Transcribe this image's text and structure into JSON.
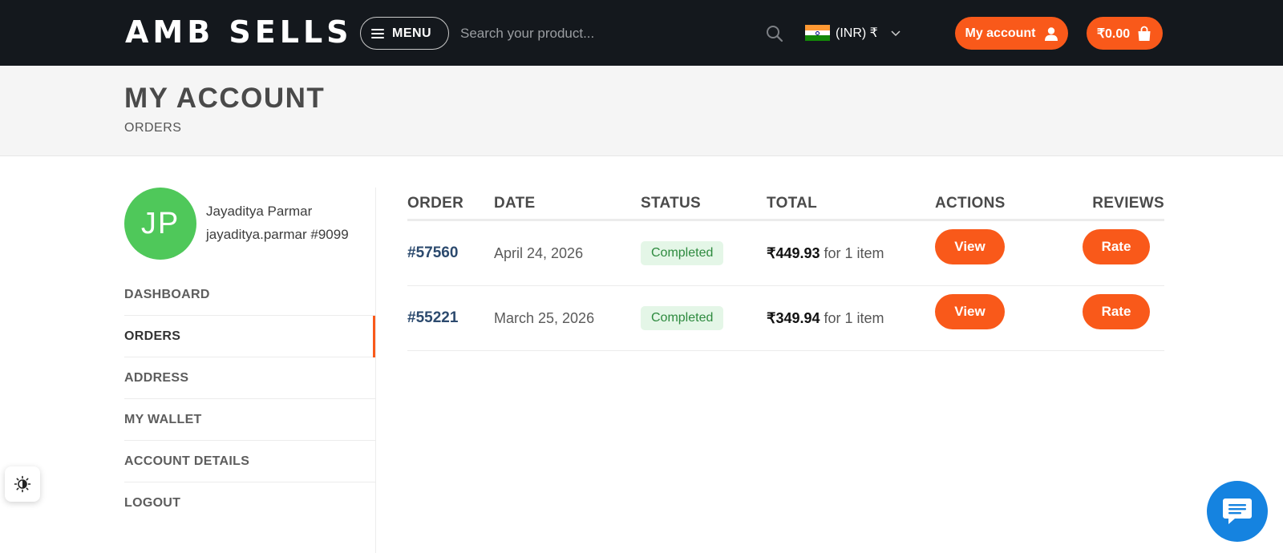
{
  "header": {
    "logo_text": "AMB SELLS",
    "menu_label": "MENU",
    "search_placeholder": "Search your product...",
    "currency_label": "(INR) ₹",
    "account_label": "My account",
    "cart_total": "₹0.00"
  },
  "page": {
    "title": "MY ACCOUNT",
    "breadcrumb": "ORDERS"
  },
  "user": {
    "initials": "JP",
    "name": "Jayaditya Parmar",
    "handle": "jayaditya.parmar #9099",
    "avatar_color": "#4fc85a"
  },
  "sidebar": {
    "items": [
      {
        "label": "DASHBOARD",
        "active": false
      },
      {
        "label": "ORDERS",
        "active": true
      },
      {
        "label": "ADDRESS",
        "active": false
      },
      {
        "label": "MY WALLET",
        "active": false
      },
      {
        "label": "ACCOUNT DETAILS",
        "active": false
      },
      {
        "label": "LOGOUT",
        "active": false
      }
    ]
  },
  "orders": {
    "columns": [
      "ORDER",
      "DATE",
      "STATUS",
      "TOTAL",
      "ACTIONS",
      "REVIEWS"
    ],
    "rows": [
      {
        "order": "#57560",
        "date": "April 24, 2026",
        "status": "Completed",
        "total": "₹449.93",
        "items": "for 1 item",
        "action": "View",
        "review": "Rate"
      },
      {
        "order": "#55221",
        "date": "March 25, 2026",
        "status": "Completed",
        "total": "₹349.94",
        "items": "for 1 item",
        "action": "View",
        "review": "Rate"
      }
    ]
  },
  "colors": {
    "accent": "#f9591a",
    "header_bg": "#14181d",
    "status_completed": "#2d8a3e",
    "chat": "#1583e0"
  },
  "icons": [
    "hamburger-icon",
    "search-icon",
    "india-flag-icon",
    "chevron-down-icon",
    "user-icon",
    "shopping-bag-icon",
    "theme-toggle-icon",
    "chat-icon"
  ]
}
